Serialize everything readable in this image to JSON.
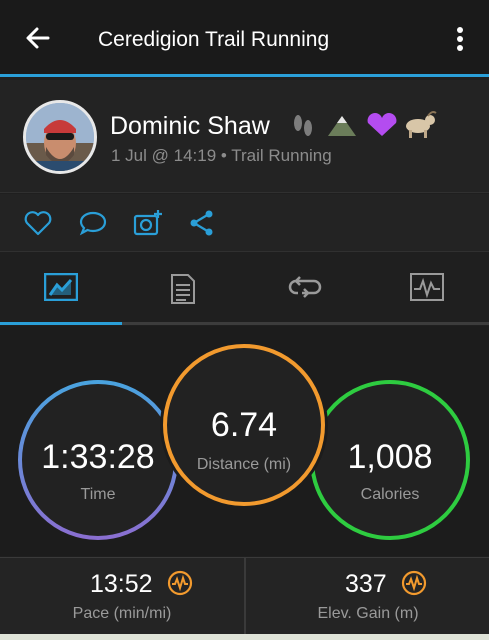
{
  "appbar": {
    "title": "Ceredigion Trail Running"
  },
  "activity": {
    "user_name": "Dominic Shaw",
    "emojis": [
      "footprints",
      "mountain",
      "purple-heart",
      "goat"
    ],
    "meta": "1 Jul @ 14:19 • Trail Running"
  },
  "tabs": [
    "stats",
    "details",
    "laps",
    "charts"
  ],
  "stats": {
    "time": {
      "value": "1:33:28",
      "label": "Time"
    },
    "distance": {
      "value": "6.74",
      "label": "Distance (mi)"
    },
    "calories": {
      "value": "1,008",
      "label": "Calories"
    }
  },
  "bottom": {
    "pace": {
      "value": "13:52",
      "label": "Pace (min/mi)"
    },
    "elev": {
      "value": "337",
      "label": "Elev. Gain (m)"
    }
  },
  "colors": {
    "accent": "#2a9fd8",
    "distance_ring": "#f29a2e",
    "calories_ring": "#2ecc40",
    "time_ring_top": "#4aa3df",
    "time_ring_bottom": "#8a6fd1",
    "chart_badge": "#f29a2e"
  }
}
